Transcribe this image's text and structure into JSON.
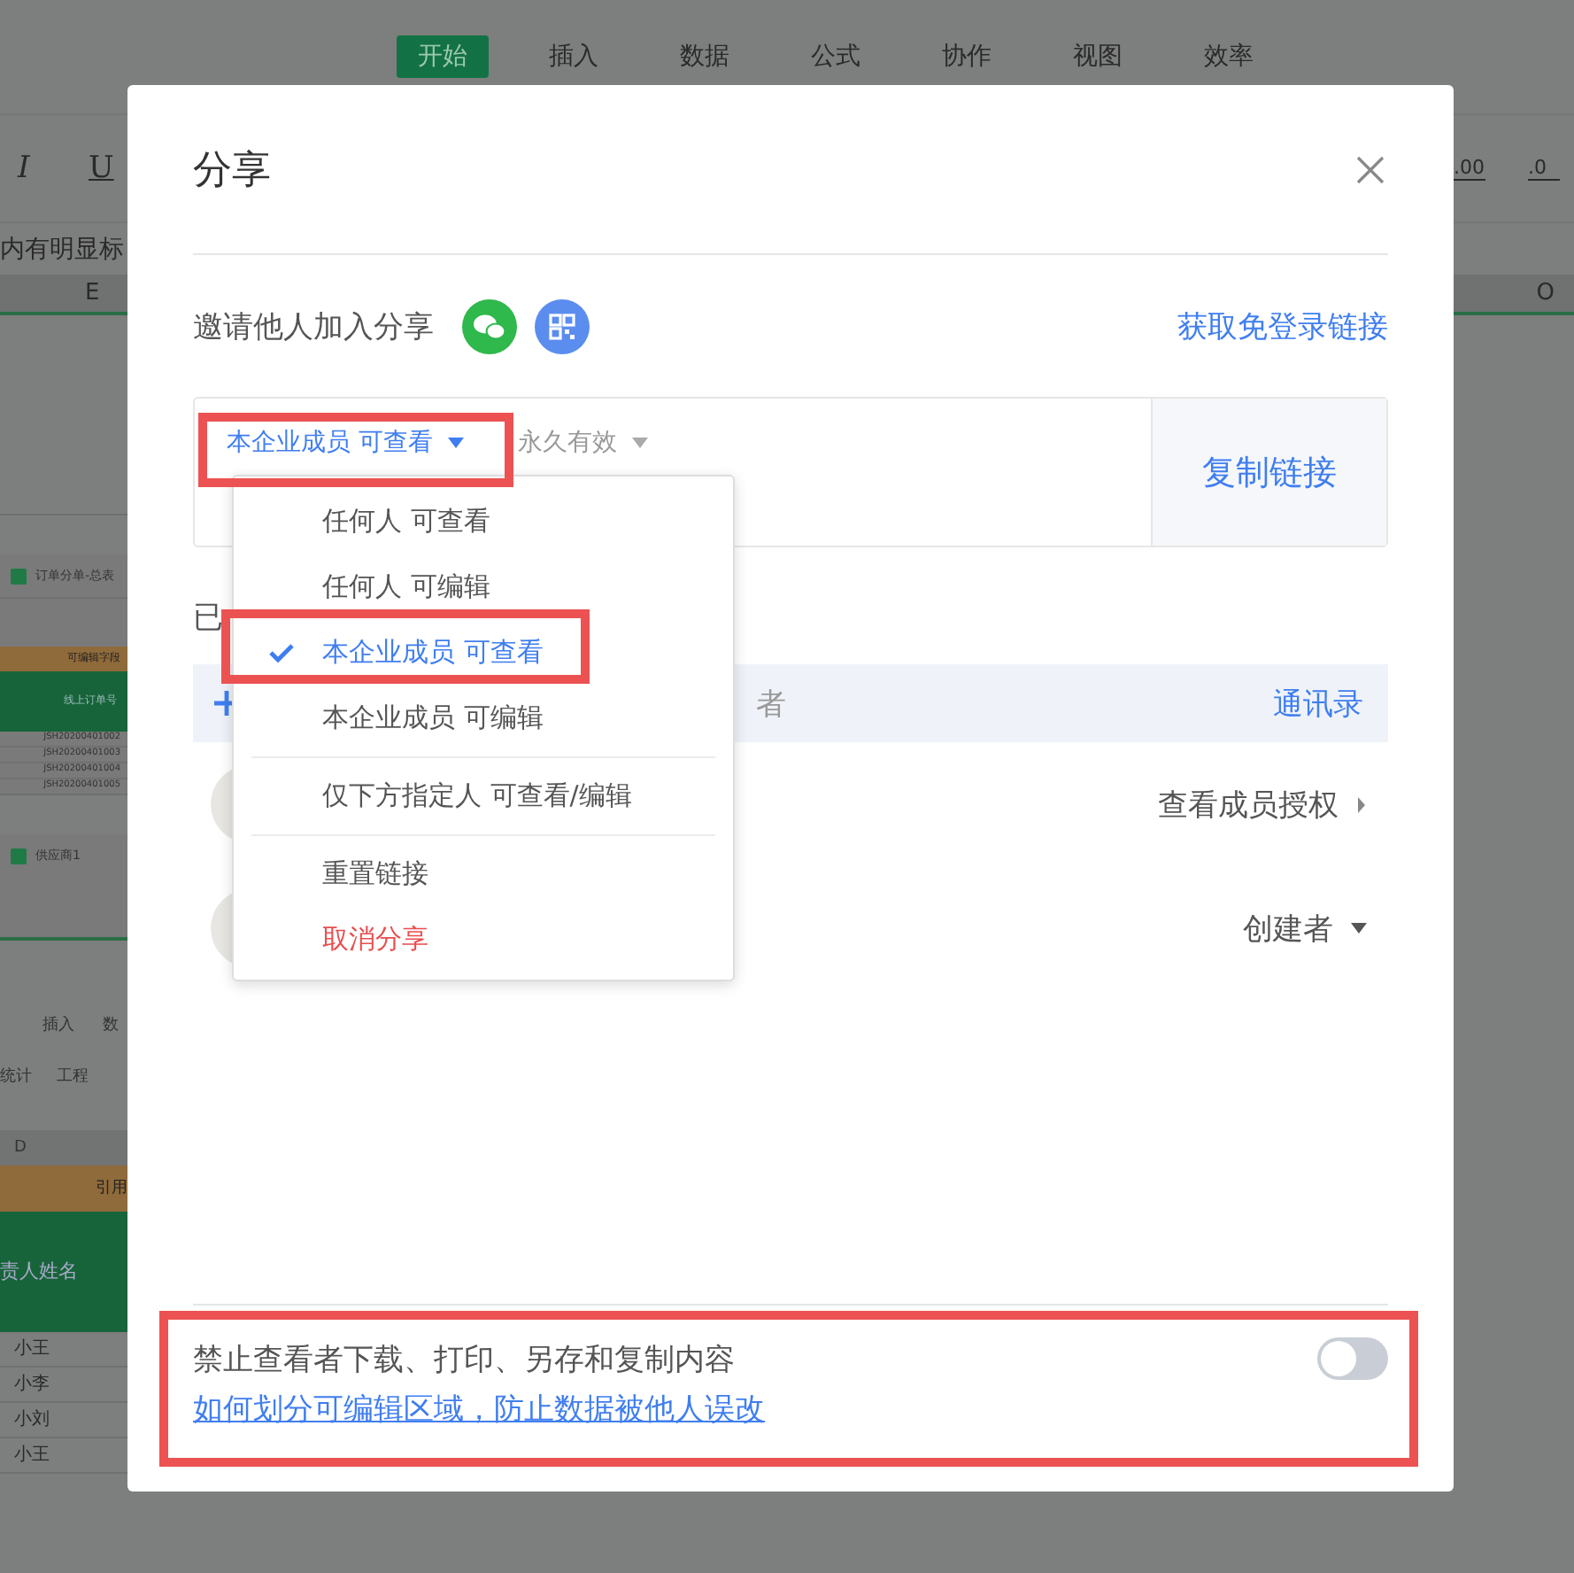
{
  "background": {
    "ribbon_tabs": [
      {
        "label": "开始",
        "selected": true
      },
      {
        "label": "插入",
        "selected": false
      },
      {
        "label": "数据",
        "selected": false
      },
      {
        "label": "公式",
        "selected": false
      },
      {
        "label": "协作",
        "selected": false
      },
      {
        "label": "视图",
        "selected": false
      },
      {
        "label": "效率",
        "selected": false
      }
    ],
    "format_buttons": [
      "I",
      "U"
    ],
    "decimal_buttons": [
      ".00",
      ".0"
    ],
    "formula_text": "内有明显标",
    "column_headers": [
      "E",
      "O"
    ],
    "thumbnail_1": {
      "title": "订单分单-总表",
      "header": "可编辑字段",
      "column": "线上订单号",
      "rows": [
        "JSH20200401002",
        "JSH20200401003",
        "JSH20200401004",
        "JSH20200401005"
      ]
    },
    "thumbnail_2": {
      "title": "供应商1"
    },
    "sheet_2": {
      "tabs": [
        "插入",
        "数"
      ],
      "tools": [
        "统计",
        "工程"
      ],
      "column": "D",
      "header": "引用",
      "name_header": "责人姓名",
      "names": [
        "小王",
        "小李",
        "小刘",
        "小王"
      ]
    }
  },
  "dialog": {
    "title": "分享",
    "invite_label": "邀请他人加入分享",
    "free_link": "获取免登录链接",
    "permission": "本企业成员 可查看",
    "permission_highlighted": true,
    "validity": "永久有效",
    "copy_button": "复制链接",
    "members_label": "已",
    "add_row": {
      "hint": "者",
      "contacts": "通讯录"
    },
    "members": [
      {
        "action": "查看成员授权",
        "kind": "link"
      },
      {
        "action": "创建者",
        "kind": "dropdown"
      }
    ],
    "restrict": {
      "label": "禁止查看者下载、打印、另存和复制内容",
      "on": false
    },
    "footer_highlighted": true,
    "help_link": "如何划分可编辑区域，防止数据被他人误改",
    "menu": [
      {
        "label": "任何人 可查看",
        "selected": false,
        "kind": "option"
      },
      {
        "label": "任何人 可编辑",
        "selected": false,
        "kind": "option"
      },
      {
        "label": "本企业成员 可查看",
        "selected": true,
        "kind": "option",
        "highlighted": true
      },
      {
        "label": "本企业成员 可编辑",
        "selected": false,
        "kind": "option"
      },
      {
        "label": "仅下方指定人 可查看/编辑",
        "selected": false,
        "kind": "option",
        "divider_before": true
      },
      {
        "label": "重置链接",
        "selected": false,
        "kind": "action",
        "divider_before": true
      },
      {
        "label": "取消分享",
        "selected": false,
        "kind": "danger"
      }
    ]
  }
}
